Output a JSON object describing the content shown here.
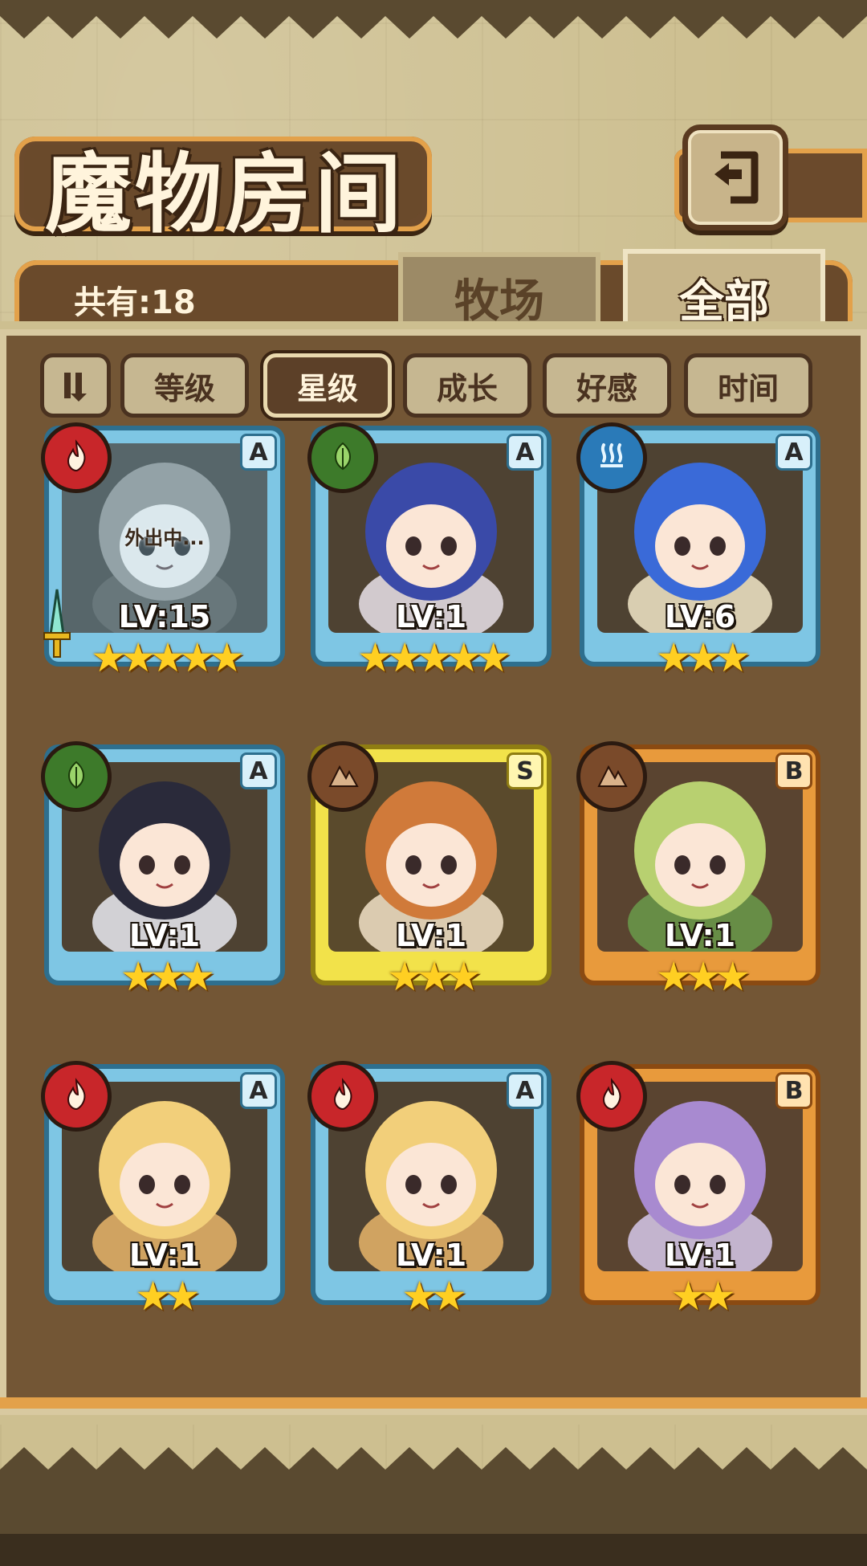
{
  "header": {
    "title": "魔物房间",
    "total_label": "共有:18"
  },
  "tabs": [
    {
      "label": "牧场",
      "active": false
    },
    {
      "label": "全部",
      "active": true
    }
  ],
  "sort_buttons": [
    {
      "label": "等级",
      "active": false
    },
    {
      "label": "星级",
      "active": true
    },
    {
      "label": "成长",
      "active": false
    },
    {
      "label": "好感",
      "active": false
    },
    {
      "label": "时间",
      "active": false
    }
  ],
  "monsters": [
    {
      "element": "fire",
      "rank": "A",
      "level": "LV:15",
      "stars": 5,
      "status": "外出中...",
      "frame": "blue",
      "has_sword": true
    },
    {
      "element": "leaf",
      "rank": "A",
      "level": "LV:1",
      "stars": 5,
      "status": "",
      "frame": "blue",
      "has_sword": false
    },
    {
      "element": "water",
      "rank": "A",
      "level": "LV:6",
      "stars": 3,
      "status": "",
      "frame": "blue",
      "has_sword": false
    },
    {
      "element": "leaf",
      "rank": "A",
      "level": "LV:1",
      "stars": 3,
      "status": "",
      "frame": "blue",
      "has_sword": false
    },
    {
      "element": "earth",
      "rank": "S",
      "level": "LV:1",
      "stars": 3,
      "status": "",
      "frame": "yellow",
      "has_sword": false
    },
    {
      "element": "earth",
      "rank": "B",
      "level": "LV:1",
      "stars": 3,
      "status": "",
      "frame": "orange",
      "has_sword": false
    },
    {
      "element": "fire",
      "rank": "A",
      "level": "LV:1",
      "stars": 2,
      "status": "",
      "frame": "blue",
      "has_sword": false
    },
    {
      "element": "fire",
      "rank": "A",
      "level": "LV:1",
      "stars": 2,
      "status": "",
      "frame": "blue",
      "has_sword": false
    },
    {
      "element": "fire",
      "rank": "B",
      "level": "LV:1",
      "stars": 2,
      "status": "",
      "frame": "orange",
      "has_sword": false
    }
  ],
  "icons": {
    "back": "back-arrow-icon",
    "sort_toggle": "sort-order-icon",
    "fire": "fire-icon",
    "leaf": "leaf-icon",
    "water": "water-icon",
    "earth": "earth-icon",
    "sword": "sword-icon"
  },
  "colors": {
    "blue_frame": "#7ec6e4",
    "yellow_frame": "#f2e24a",
    "orange_frame": "#e89a3c",
    "fire_badge": "#c8262a",
    "leaf_badge": "#3d7a2a",
    "water_badge": "#2a7ab8",
    "earth_badge": "#7a4a2a",
    "panel_brown": "#735635",
    "gold_trim": "#e3a14a"
  }
}
